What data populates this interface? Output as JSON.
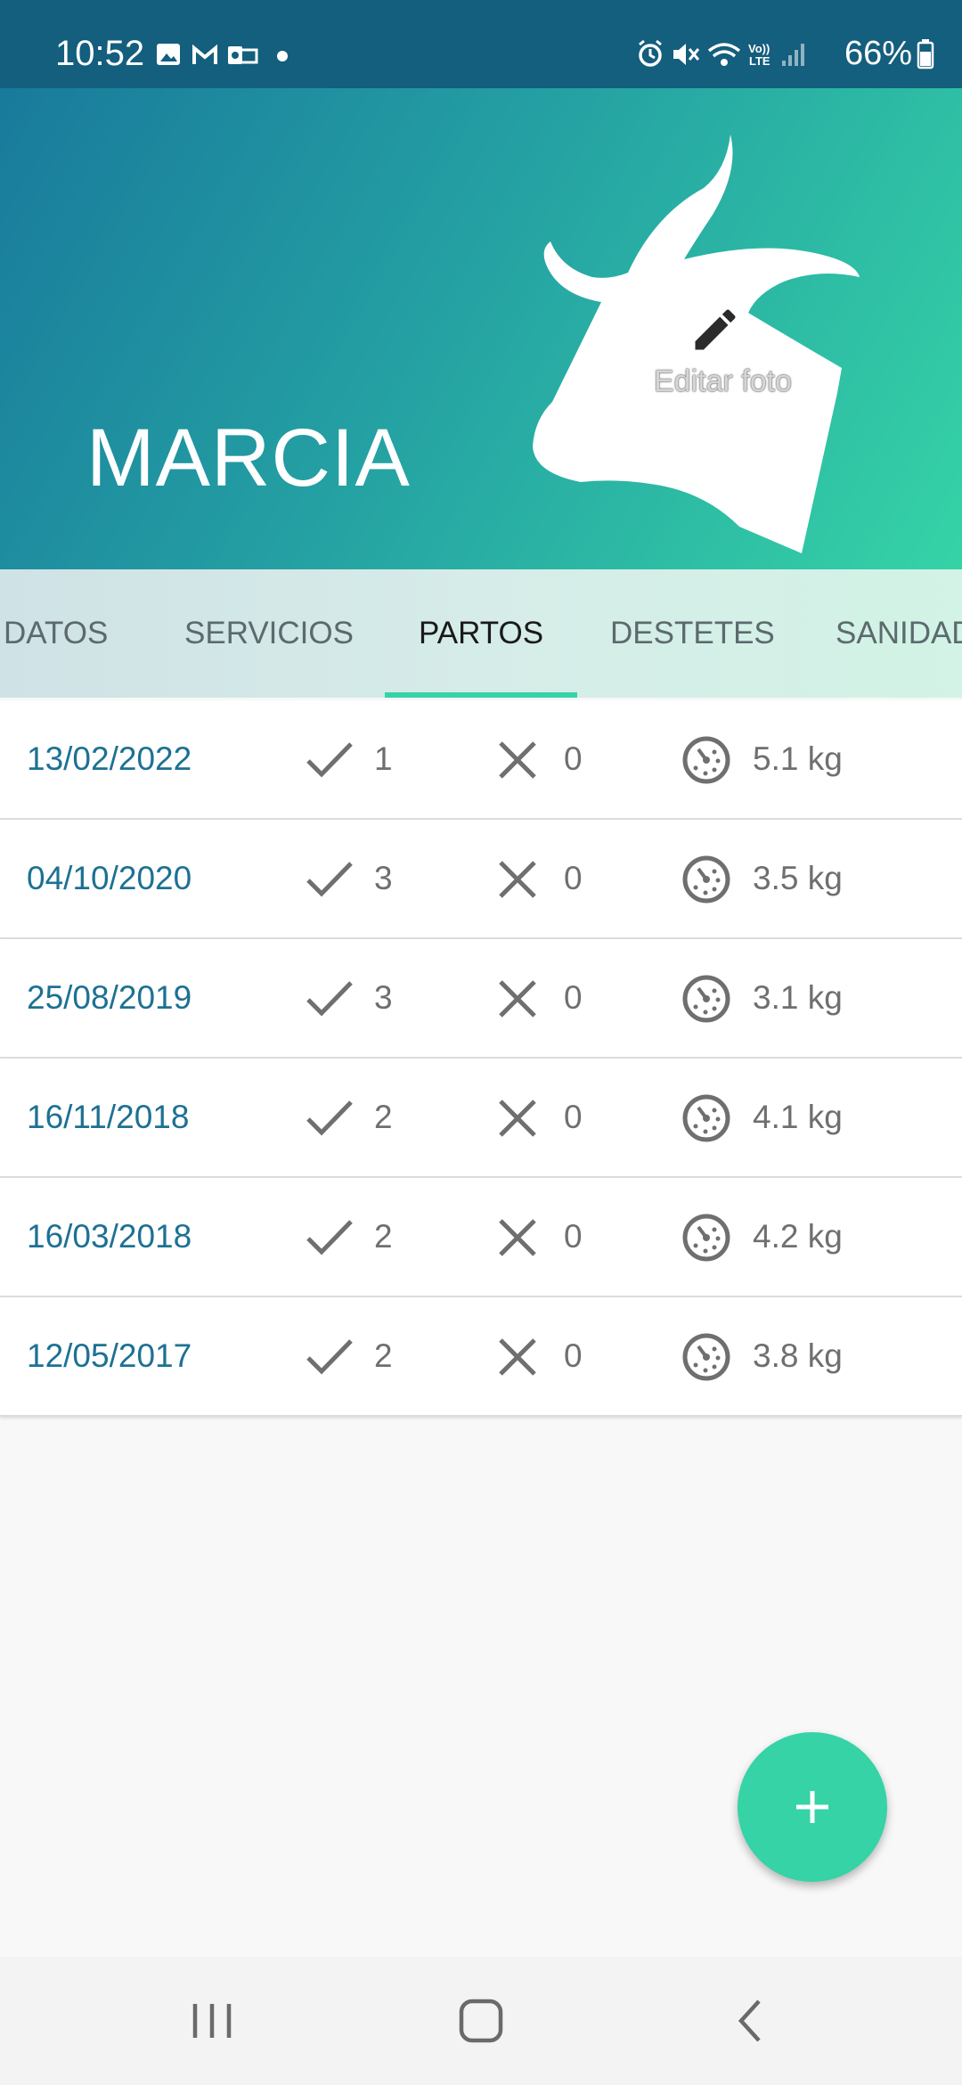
{
  "status_bar": {
    "time": "10:52",
    "battery": "66%",
    "left_icons": [
      "image-icon",
      "gmail-icon",
      "outlook-icon",
      "dot-icon"
    ],
    "right_icons": [
      "alarm-icon",
      "mute-icon",
      "wifi-icon",
      "volte-icon",
      "signal-icon",
      "battery-icon"
    ]
  },
  "header": {
    "animal_name": "MARCIA",
    "edit_photo_label": "Editar foto",
    "colors": {
      "gradient_start": "#197a9c",
      "gradient_end": "#35d3a6"
    }
  },
  "tabs": [
    {
      "label": "DATOS",
      "active": false
    },
    {
      "label": "SERVICIOS",
      "active": false
    },
    {
      "label": "PARTOS",
      "active": true
    },
    {
      "label": "DESTETES",
      "active": false
    },
    {
      "label": "SANIDAD",
      "active": false
    }
  ],
  "births": [
    {
      "date": "13/02/2022",
      "alive": "1",
      "dead": "0",
      "weight": "5.1 kg"
    },
    {
      "date": "04/10/2020",
      "alive": "3",
      "dead": "0",
      "weight": "3.5 kg"
    },
    {
      "date": "25/08/2019",
      "alive": "3",
      "dead": "0",
      "weight": "3.1 kg"
    },
    {
      "date": "16/11/2018",
      "alive": "2",
      "dead": "0",
      "weight": "4.1 kg"
    },
    {
      "date": "16/03/2018",
      "alive": "2",
      "dead": "0",
      "weight": "4.2 kg"
    },
    {
      "date": "12/05/2017",
      "alive": "2",
      "dead": "0",
      "weight": "3.8 kg"
    }
  ],
  "fab": {
    "icon": "plus-icon"
  },
  "nav_bar": {
    "icons": [
      "recent-apps-icon",
      "home-icon",
      "back-icon"
    ]
  }
}
